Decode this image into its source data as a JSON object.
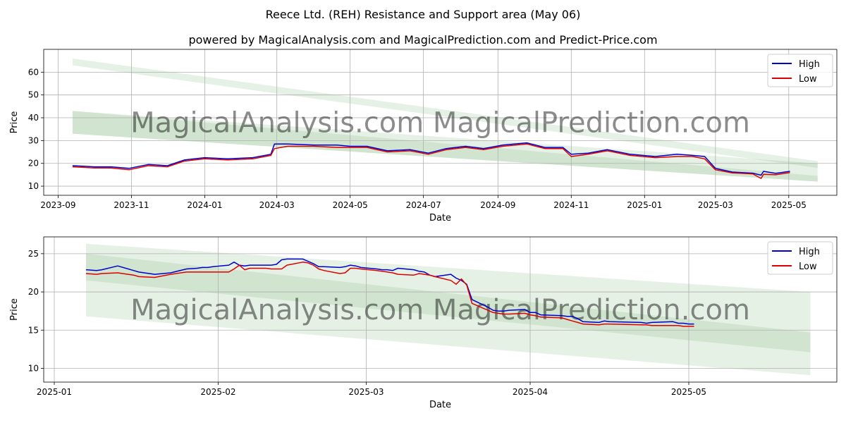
{
  "title": "Reece Ltd. (REH) Resistance and Support area (May 06)",
  "subtitle": "powered by MagicalAnalysis.com and MagicalPrediction.com and Predict-Price.com",
  "watermark": "MagicalAnalysis.com    MagicalPrediction.com",
  "colors": {
    "high": "#0000cc",
    "low": "#dd0000",
    "band": "#2e8b2e",
    "grid": "#b0b0b0"
  },
  "chart_data": [
    {
      "type": "line",
      "xlabel": "Date",
      "ylabel": "Price",
      "legend": {
        "position": "top-right",
        "entries": [
          "High",
          "Low"
        ]
      },
      "grid": true,
      "xlim": [
        "2023-08-20",
        "2025-06-10"
      ],
      "ylim": [
        6,
        70
      ],
      "x_ticks": [
        "2023-09",
        "2023-11",
        "2024-01",
        "2024-03",
        "2024-05",
        "2024-07",
        "2024-09",
        "2024-11",
        "2025-01",
        "2025-03",
        "2025-05"
      ],
      "y_ticks": [
        10,
        20,
        30,
        40,
        50,
        60
      ],
      "bands": [
        {
          "x": [
            "2023-09-13",
            "2025-05-25"
          ],
          "upper": [
            66,
            21
          ],
          "lower": [
            63,
            18
          ]
        },
        {
          "x": [
            "2023-09-13",
            "2025-05-25"
          ],
          "upper": [
            43,
            20
          ],
          "lower": [
            33,
            12
          ]
        },
        {
          "x": [
            "2023-09-13",
            "2025-05-25"
          ],
          "upper": [
            43,
            14.5
          ],
          "lower": [
            33,
            12
          ]
        }
      ],
      "series": [
        {
          "name": "High",
          "x": [
            "2023-09-13",
            "2023-10-01",
            "2023-10-15",
            "2023-10-30",
            "2023-11-15",
            "2023-12-01",
            "2023-12-15",
            "2024-01-01",
            "2024-01-20",
            "2024-02-10",
            "2024-02-25",
            "2024-02-28",
            "2024-03-10",
            "2024-04-01",
            "2024-04-20",
            "2024-05-01",
            "2024-05-15",
            "2024-06-01",
            "2024-06-20",
            "2024-07-05",
            "2024-07-20",
            "2024-08-05",
            "2024-08-20",
            "2024-09-05",
            "2024-09-25",
            "2024-10-10",
            "2024-10-25",
            "2024-11-01",
            "2024-11-15",
            "2024-12-01",
            "2024-12-20",
            "2025-01-10",
            "2025-01-28",
            "2025-02-10",
            "2025-02-20",
            "2025-03-01",
            "2025-03-15",
            "2025-04-01",
            "2025-04-08",
            "2025-04-10",
            "2025-04-20",
            "2025-05-02"
          ],
          "values": [
            19,
            18.5,
            18.5,
            17.8,
            19.5,
            19,
            21.5,
            22.5,
            22,
            22.5,
            24,
            28.5,
            28.5,
            28,
            28,
            27.5,
            27.5,
            25.5,
            26,
            24.5,
            26.5,
            27.5,
            26.5,
            28,
            29,
            27,
            27,
            24,
            24.5,
            26,
            24,
            23,
            24,
            23.5,
            23,
            17.8,
            16.2,
            15.7,
            14.8,
            16.5,
            15.6,
            16.5
          ]
        },
        {
          "name": "Low",
          "x": [
            "2023-09-13",
            "2023-10-01",
            "2023-10-15",
            "2023-10-30",
            "2023-11-15",
            "2023-12-01",
            "2023-12-15",
            "2024-01-01",
            "2024-01-20",
            "2024-02-10",
            "2024-02-25",
            "2024-02-28",
            "2024-03-10",
            "2024-04-01",
            "2024-04-20",
            "2024-05-01",
            "2024-05-15",
            "2024-06-01",
            "2024-06-20",
            "2024-07-05",
            "2024-07-20",
            "2024-08-05",
            "2024-08-20",
            "2024-09-05",
            "2024-09-25",
            "2024-10-10",
            "2024-10-25",
            "2024-11-01",
            "2024-11-15",
            "2024-12-01",
            "2024-12-20",
            "2025-01-10",
            "2025-01-28",
            "2025-02-10",
            "2025-02-20",
            "2025-03-01",
            "2025-03-15",
            "2025-04-01",
            "2025-04-08",
            "2025-04-10",
            "2025-04-20",
            "2025-05-02"
          ],
          "values": [
            18.5,
            18,
            18,
            17.2,
            19,
            18.5,
            21,
            22,
            21.5,
            22,
            23.5,
            26.5,
            27.5,
            27.5,
            27,
            27,
            27,
            25,
            25.5,
            24,
            26,
            27,
            26,
            27.5,
            28.5,
            26.5,
            26.5,
            23,
            24,
            25.5,
            23.5,
            22.5,
            23,
            23,
            22,
            17.2,
            15.8,
            15.4,
            13.4,
            15.2,
            15,
            16
          ]
        }
      ]
    },
    {
      "type": "line",
      "xlabel": "Date",
      "ylabel": "Price",
      "legend": {
        "position": "top-right",
        "entries": [
          "High",
          "Low"
        ]
      },
      "grid": true,
      "xlim": [
        "2024-12-30",
        "2025-05-29"
      ],
      "ylim": [
        8.2,
        27.2
      ],
      "x_ticks": [
        "2025-01",
        "2025-02",
        "2025-03",
        "2025-04",
        "2025-05"
      ],
      "y_ticks": [
        10,
        15,
        20,
        25
      ],
      "bands": [
        {
          "x": [
            "2025-01-07",
            "2025-05-24"
          ],
          "upper": [
            26.3,
            20
          ],
          "lower": [
            16.8,
            9.1
          ]
        },
        {
          "x": [
            "2025-01-07",
            "2025-05-24"
          ],
          "upper": [
            25.0,
            14.7
          ],
          "lower": [
            21.5,
            12.1
          ]
        }
      ],
      "series": [
        {
          "name": "High",
          "x": [
            "2025-01-07",
            "2025-01-09",
            "2025-01-10",
            "2025-01-13",
            "2025-01-16",
            "2025-01-17",
            "2025-01-20",
            "2025-01-23",
            "2025-01-26",
            "2025-01-28",
            "2025-01-29",
            "2025-01-30",
            "2025-01-31",
            "2025-02-03",
            "2025-02-04",
            "2025-02-05",
            "2025-02-06",
            "2025-02-07",
            "2025-02-10",
            "2025-02-11",
            "2025-02-12",
            "2025-02-13",
            "2025-02-14",
            "2025-02-17",
            "2025-02-18",
            "2025-02-19",
            "2025-02-20",
            "2025-02-21",
            "2025-02-24",
            "2025-02-25",
            "2025-02-26",
            "2025-02-27",
            "2025-02-28",
            "2025-03-03",
            "2025-03-04",
            "2025-03-05",
            "2025-03-06",
            "2025-03-07",
            "2025-03-10",
            "2025-03-11",
            "2025-03-12",
            "2025-03-13",
            "2025-03-14",
            "2025-03-17",
            "2025-03-18",
            "2025-03-19",
            "2025-03-20",
            "2025-03-21",
            "2025-03-24",
            "2025-03-25",
            "2025-03-26",
            "2025-03-27",
            "2025-03-28",
            "2025-03-31",
            "2025-04-01",
            "2025-04-02",
            "2025-04-03",
            "2025-04-07",
            "2025-04-08",
            "2025-04-09",
            "2025-04-10",
            "2025-04-11",
            "2025-04-14",
            "2025-04-15",
            "2025-04-16",
            "2025-04-22",
            "2025-04-23",
            "2025-04-24",
            "2025-04-28",
            "2025-04-29",
            "2025-04-30",
            "2025-05-01",
            "2025-05-02"
          ],
          "values": [
            22.9,
            22.8,
            22.9,
            23.4,
            22.8,
            22.6,
            22.3,
            22.5,
            23.0,
            23.1,
            23.2,
            23.2,
            23.3,
            23.5,
            23.9,
            23.5,
            23.4,
            23.5,
            23.5,
            23.5,
            23.6,
            24.2,
            24.3,
            24.3,
            24.0,
            23.7,
            23.3,
            23.3,
            23.2,
            23.3,
            23.5,
            23.4,
            23.2,
            23.0,
            22.9,
            22.9,
            22.8,
            23.1,
            22.9,
            22.7,
            22.6,
            22.2,
            22.0,
            22.3,
            21.8,
            21.5,
            21.0,
            19.0,
            18.0,
            17.6,
            17.5,
            17.5,
            17.6,
            17.7,
            17.3,
            17.3,
            17.0,
            16.9,
            16.8,
            16.8,
            16.5,
            16.1,
            16.0,
            16.2,
            16.1,
            16.0,
            15.9,
            16.0,
            16.1,
            15.9,
            15.9,
            15.8,
            15.8
          ]
        },
        {
          "name": "Low",
          "x": [
            "2025-01-07",
            "2025-01-09",
            "2025-01-10",
            "2025-01-13",
            "2025-01-16",
            "2025-01-17",
            "2025-01-20",
            "2025-01-23",
            "2025-01-26",
            "2025-01-28",
            "2025-01-29",
            "2025-01-30",
            "2025-01-31",
            "2025-02-03",
            "2025-02-04",
            "2025-02-05",
            "2025-02-06",
            "2025-02-07",
            "2025-02-10",
            "2025-02-11",
            "2025-02-12",
            "2025-02-13",
            "2025-02-14",
            "2025-02-17",
            "2025-02-18",
            "2025-02-19",
            "2025-02-20",
            "2025-02-21",
            "2025-02-24",
            "2025-02-25",
            "2025-02-26",
            "2025-02-27",
            "2025-02-28",
            "2025-03-03",
            "2025-03-04",
            "2025-03-05",
            "2025-03-06",
            "2025-03-07",
            "2025-03-10",
            "2025-03-11",
            "2025-03-12",
            "2025-03-13",
            "2025-03-14",
            "2025-03-17",
            "2025-03-18",
            "2025-03-19",
            "2025-03-20",
            "2025-03-21",
            "2025-03-24",
            "2025-03-25",
            "2025-03-26",
            "2025-03-27",
            "2025-03-28",
            "2025-03-31",
            "2025-04-01",
            "2025-04-02",
            "2025-04-03",
            "2025-04-07",
            "2025-04-08",
            "2025-04-09",
            "2025-04-10",
            "2025-04-11",
            "2025-04-14",
            "2025-04-15",
            "2025-04-16",
            "2025-04-22",
            "2025-04-23",
            "2025-04-24",
            "2025-04-28",
            "2025-04-29",
            "2025-04-30",
            "2025-05-01",
            "2025-05-02"
          ],
          "values": [
            22.4,
            22.3,
            22.4,
            22.5,
            22.2,
            22.0,
            21.9,
            22.3,
            22.6,
            22.6,
            22.6,
            22.6,
            22.6,
            22.6,
            23.0,
            23.5,
            22.9,
            23.1,
            23.1,
            23.0,
            23.0,
            23.0,
            23.5,
            23.9,
            23.8,
            23.5,
            23.0,
            22.8,
            22.4,
            22.5,
            23.1,
            23.1,
            23.0,
            22.8,
            22.7,
            22.6,
            22.5,
            22.3,
            22.2,
            22.4,
            22.3,
            22.2,
            22.0,
            21.5,
            21.0,
            21.7,
            20.9,
            18.5,
            17.6,
            17.3,
            17.2,
            17.1,
            17.1,
            17.2,
            17.0,
            16.9,
            16.7,
            16.6,
            16.4,
            16.2,
            16.0,
            15.8,
            15.7,
            15.8,
            15.8,
            15.7,
            15.7,
            15.6,
            15.6,
            15.6,
            15.5,
            15.5,
            15.5
          ]
        }
      ]
    }
  ]
}
